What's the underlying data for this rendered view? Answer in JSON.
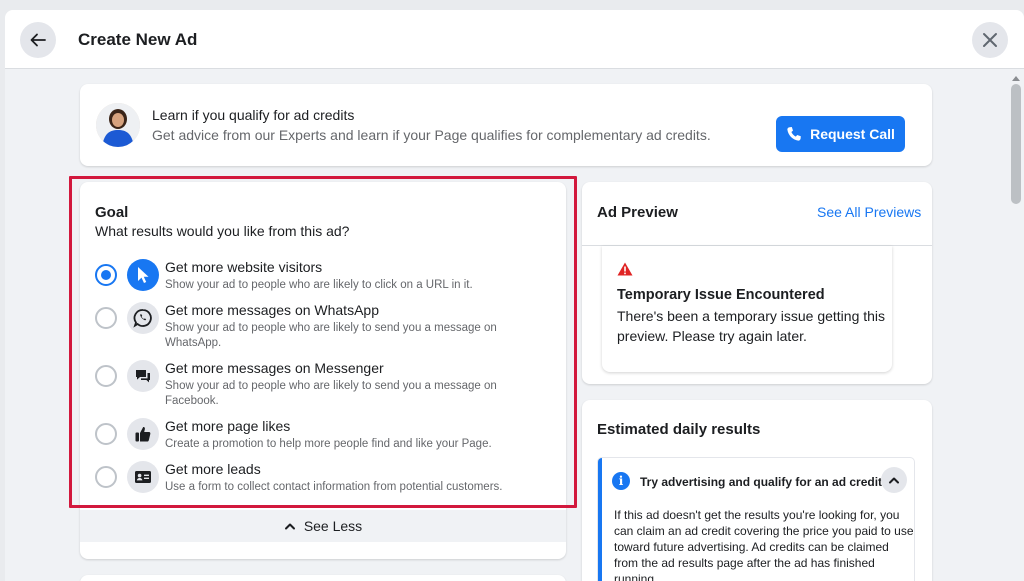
{
  "header": {
    "title": "Create New Ad",
    "back_icon": "arrow-left-icon",
    "close_icon": "close-icon"
  },
  "promo": {
    "title": "Learn if you qualify for ad credits",
    "subtitle": "Get advice from our Experts and learn if your Page qualifies for complementary ad credits.",
    "button_label": "Request Call",
    "button_icon": "phone-icon"
  },
  "goal": {
    "title": "Goal",
    "subtitle": "What results would you like from this ad?",
    "options": [
      {
        "label": "Get more website visitors",
        "desc": "Show your ad to people who are likely to click on a URL in it.",
        "icon": "cursor-icon",
        "selected": true
      },
      {
        "label": "Get more messages on WhatsApp",
        "desc": "Show your ad to people who are likely to send you a message on WhatsApp.",
        "icon": "whatsapp-icon",
        "selected": false
      },
      {
        "label": "Get more messages on Messenger",
        "desc": "Show your ad to people who are likely to send you a message on Facebook.",
        "icon": "messenger-icon",
        "selected": false
      },
      {
        "label": "Get more page likes",
        "desc": "Create a promotion to help more people find and like your Page.",
        "icon": "thumbs-up-icon",
        "selected": false
      },
      {
        "label": "Get more leads",
        "desc": "Use a form to collect contact information from potential customers.",
        "icon": "contact-card-icon",
        "selected": false
      }
    ],
    "see_less_label": "See Less"
  },
  "preview": {
    "title": "Ad Preview",
    "see_all_label": "See All Previews",
    "issue_title": "Temporary Issue Encountered",
    "issue_text": "There's been a temporary issue getting this preview. Please try again later."
  },
  "results": {
    "title": "Estimated daily results",
    "tip_title": "Try advertising and qualify for an ad credit",
    "tip_text": "If this ad doesn't get the results you're looking for, you can claim an ad credit covering the price you paid to use toward future advertising. Ad credits can be claimed from the ad results page after the ad has finished running."
  },
  "colors": {
    "accent": "#1877f2",
    "highlight_outline": "#d2183d",
    "warning": "#e02424"
  }
}
